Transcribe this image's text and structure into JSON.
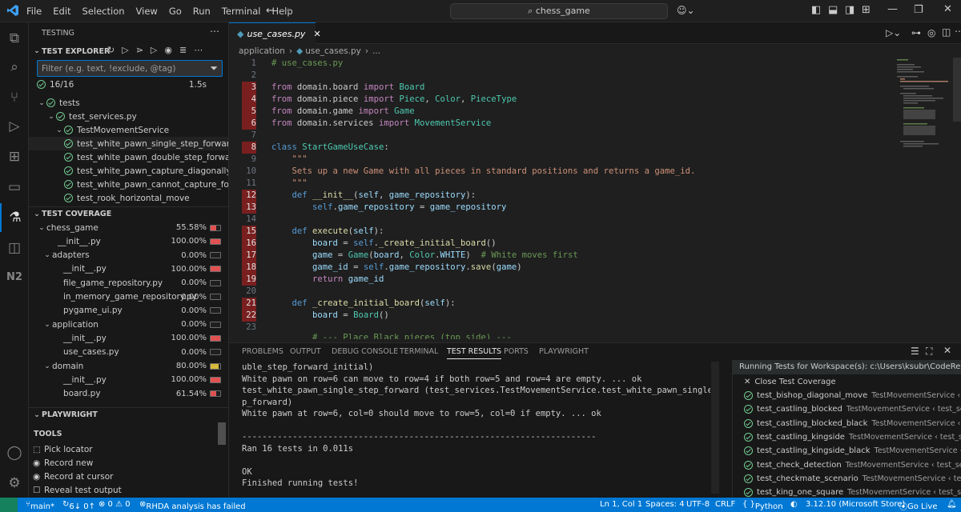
{
  "menu": [
    "File",
    "Edit",
    "Selection",
    "View",
    "Go",
    "Run",
    "Terminal",
    "Help"
  ],
  "search": {
    "text": "chess_game"
  },
  "sidebar": {
    "title": "TESTING",
    "explorer_title": "TEST EXPLORER",
    "filter_placeholder": "Filter (e.g. text, !exclude, @tag)",
    "summary": "16/16",
    "duration": "1.5s",
    "tree": {
      "root": "tests",
      "file": "test_services.py",
      "suite": "TestMovementService",
      "tests": [
        "test_white_pawn_single_step_forward",
        "test_white_pawn_double_step_forward_in...",
        "test_white_pawn_capture_diagonally",
        "test_white_pawn_cannot_capture_forward",
        "test_rook_horizontal_move"
      ]
    },
    "coverage_title": "TEST COVERAGE",
    "coverage": [
      {
        "label": "chess_game",
        "pct": "55.58%",
        "fill": 0.56,
        "color": "#e05252",
        "indent": 0,
        "chev": "⌄"
      },
      {
        "label": "__init__.py",
        "pct": "100.00%",
        "fill": 1,
        "color": "#e05252",
        "indent": 1,
        "chev": ""
      },
      {
        "label": "adapters",
        "pct": "0.00%",
        "fill": 0,
        "color": "#e05252",
        "indent": 0.5,
        "chev": "⌄"
      },
      {
        "label": "__init__.py",
        "pct": "100.00%",
        "fill": 1,
        "color": "#e05252",
        "indent": 1.5,
        "chev": ""
      },
      {
        "label": "file_game_repository.py",
        "pct": "0.00%",
        "fill": 0,
        "color": "#e05252",
        "indent": 1.5,
        "chev": ""
      },
      {
        "label": "in_memory_game_repository.py",
        "pct": "0.00%",
        "fill": 0,
        "color": "#e05252",
        "indent": 1.5,
        "chev": ""
      },
      {
        "label": "pygame_ui.py",
        "pct": "0.00%",
        "fill": 0,
        "color": "#e05252",
        "indent": 1.5,
        "chev": ""
      },
      {
        "label": "application",
        "pct": "0.00%",
        "fill": 0,
        "color": "#e05252",
        "indent": 0.5,
        "chev": "⌄"
      },
      {
        "label": "__init__.py",
        "pct": "100.00%",
        "fill": 1,
        "color": "#e05252",
        "indent": 1.5,
        "chev": ""
      },
      {
        "label": "use_cases.py",
        "pct": "0.00%",
        "fill": 0,
        "color": "#e05252",
        "indent": 1.5,
        "chev": ""
      },
      {
        "label": "domain",
        "pct": "80.00%",
        "fill": 0.8,
        "color": "#d7ba3a",
        "indent": 0.5,
        "chev": "⌄"
      },
      {
        "label": "__init__.py",
        "pct": "100.00%",
        "fill": 1,
        "color": "#e05252",
        "indent": 1.5,
        "chev": ""
      },
      {
        "label": "board.py",
        "pct": "61.54%",
        "fill": 0.62,
        "color": "#e05252",
        "indent": 1.5,
        "chev": ""
      }
    ],
    "playwright_title": "PLAYWRIGHT",
    "tools_title": "TOOLS",
    "tools": [
      "Pick locator",
      "Record new",
      "Record at cursor",
      "Reveal test output"
    ]
  },
  "editor": {
    "tab": "use_cases.py",
    "breadcrumb": [
      "application",
      "use_cases.py",
      "..."
    ],
    "line_numbers": [
      "1",
      "2",
      "3",
      "4",
      "5",
      "6",
      "7",
      "8",
      "9",
      "10",
      "11",
      "12",
      "13",
      "14",
      "15",
      "16",
      "17",
      "18",
      "19",
      "20",
      "21",
      "22",
      "23"
    ],
    "highlighted_lines": [
      3,
      4,
      5,
      6,
      8,
      12,
      13,
      15,
      16,
      17,
      18,
      19,
      21,
      22
    ]
  },
  "panel": {
    "tabs": [
      "PROBLEMS",
      "OUTPUT",
      "DEBUG CONSOLE",
      "TERMINAL",
      "TEST RESULTS",
      "PORTS",
      "PLAYWRIGHT"
    ],
    "active_tab": "TEST RESULTS",
    "output": [
      "uble_step_forward_initial)",
      "White pawn on row=6 can move to row=4 if both row=5 and row=4 are empty. ... ok",
      "test_white_pawn_single_step_forward (test_services.TestMovementService.test_white_pawn_single_ste",
      "p_forward)",
      "White pawn at row=6, col=0 should move to row=5, col=0 if empty. ... ok",
      "",
      "----------------------------------------------------------------------",
      "Ran 16 tests in 0.011s",
      "",
      "OK",
      "Finished running tests!"
    ],
    "run_header": "Running Tests for Workspace(s): c:\\Users\\ksubr\\CodeRepo\\G...",
    "close_coverage": "Close Test Coverage",
    "results": [
      {
        "name": "test_bishop_diagonal_move",
        "desc": "TestMovementService ‹ test_se..."
      },
      {
        "name": "test_castling_blocked",
        "desc": "TestMovementService ‹ test_services..."
      },
      {
        "name": "test_castling_blocked_black",
        "desc": "TestMovementService ‹ test_se..."
      },
      {
        "name": "test_castling_kingside",
        "desc": "TestMovementService ‹ test_services..."
      },
      {
        "name": "test_castling_kingside_black",
        "desc": "TestMovementService ‹ test_s..."
      },
      {
        "name": "test_check_detection",
        "desc": "TestMovementService ‹ test_services.p..."
      },
      {
        "name": "test_checkmate_scenario",
        "desc": "TestMovementService ‹ test_servi..."
      },
      {
        "name": "test_king_one_square",
        "desc": "TestMovementService ‹ test_services..."
      }
    ]
  },
  "status": {
    "branch": "main*",
    "sync": "6↓ 0↑",
    "errors": "⊗ 0 ⚠ 0",
    "rhda": "RHDA analysis has failed",
    "position": "Ln 1, Col 1",
    "spaces": "Spaces: 4",
    "encoding": "UTF-8",
    "eol": "CRLF",
    "lang": "Python",
    "interpreter": "3.12.10 (Microsoft Store)",
    "golive": "Go Live"
  },
  "colors": {
    "accent": "#0078d4",
    "pass": "#73c991",
    "uncovered": "#7a1f1f"
  }
}
